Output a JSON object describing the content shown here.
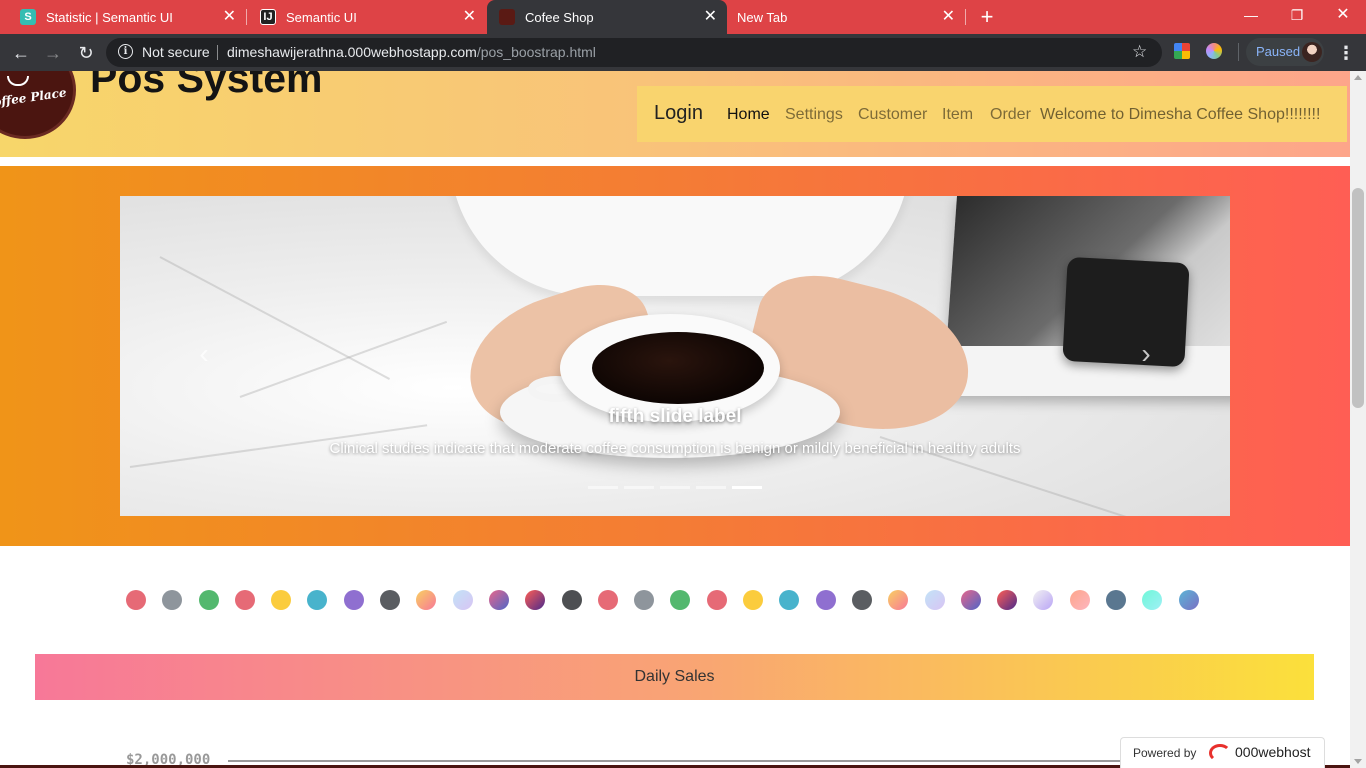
{
  "browser": {
    "tabs": [
      {
        "title": "Statistic | Semantic UI",
        "icon": "S",
        "icon_color": "#35bdb2"
      },
      {
        "title": "Semantic UI",
        "icon": "IJ",
        "icon_color": "#222222"
      },
      {
        "title": "Cofee Shop",
        "icon": "",
        "icon_color": "#5a1a14"
      },
      {
        "title": "New Tab",
        "icon": "",
        "icon_color": ""
      }
    ],
    "active_tab_index": 2,
    "security_label": "Not secure",
    "url_host": "dimeshawijerathna.000webhostapp.com",
    "url_path": "/pos_boostrap.html",
    "profile_status": "Paused"
  },
  "header": {
    "logo_text": "offee Place",
    "title": "Pos System"
  },
  "nav": {
    "login": "Login",
    "links": [
      "Home",
      "Settings",
      "Customer",
      "Item",
      "Order"
    ],
    "active_link": "Home",
    "welcome": "Welcome to Dimesha Coffee Shop!!!!!!!!"
  },
  "carousel": {
    "slide_title": "fifth slide label",
    "slide_caption": "Clinical studies indicate that moderate coffee consumption is benign or mildly beneficial in healthy adults",
    "slide_count": 5,
    "active_index": 4
  },
  "swatch_colors": [
    "#e66a76",
    "#8e959c",
    "#53b86e",
    "#e66a76",
    "#fbcc3d",
    "#48b3cc",
    "#8f6fd0",
    "#5a5d61",
    "linear-gradient(135deg,#f9d061,#f77898)",
    "linear-gradient(135deg,#c2e3f7,#d8c4f4)",
    "linear-gradient(135deg,#e8678b,#4e65c7)",
    "linear-gradient(135deg,#ff5e54,#4b2a8c)",
    "#4d4f52",
    "#e66a76",
    "#8e959c",
    "#53b86e",
    "#e66a76",
    "#fbcc3d",
    "#48b3cc",
    "#8f6fd0",
    "#5a5d61",
    "linear-gradient(135deg,#f9d061,#f77898)",
    "linear-gradient(135deg,#c2e3f7,#d8c4f4)",
    "linear-gradient(135deg,#e8678b,#4e65c7)",
    "linear-gradient(135deg,#ff5e54,#4b2a8c)",
    "linear-gradient(135deg,#f2f2f2,#b9a4f6)",
    "linear-gradient(135deg,#fda58a,#fdb6c0)",
    "#5a7790",
    "linear-gradient(135deg,#6ff7d8,#9ff0f5)",
    "linear-gradient(135deg,#5bb5d6,#7a6fc4)"
  ],
  "daily_sales": {
    "label": "Daily Sales",
    "y_tick": "$2,000,000"
  },
  "footer": {
    "powered_by": "Powered by",
    "host_name": "000webhost"
  }
}
